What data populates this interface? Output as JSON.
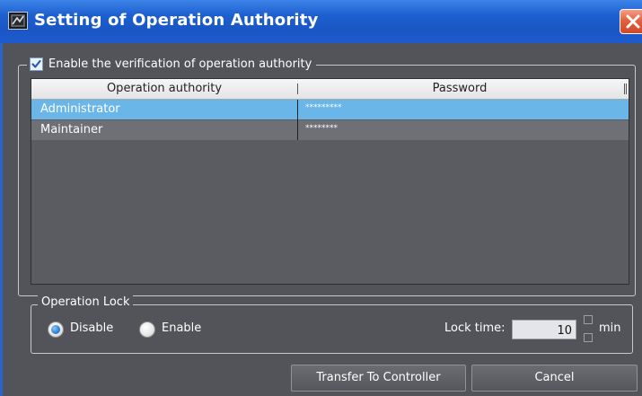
{
  "window": {
    "title": "Setting of Operation Authority"
  },
  "verification": {
    "label": "Enable the verification of operation authority",
    "checked": true
  },
  "table": {
    "columns": [
      "Operation authority",
      "Password"
    ],
    "rows": [
      {
        "authority": "Administrator",
        "password": "*********",
        "selected": true
      },
      {
        "authority": "Maintainer",
        "password": "********",
        "selected": false
      }
    ]
  },
  "operation_lock": {
    "title": "Operation Lock",
    "options": [
      "Disable",
      "Enable"
    ],
    "selected": "Disable",
    "lock_time_label": "Lock time:",
    "lock_time_value": "10",
    "unit": "min"
  },
  "buttons": {
    "transfer": "Transfer To Controller",
    "cancel": "Cancel"
  },
  "colors": {
    "titlebar": "#1d5fd0",
    "selection": "#6ab6e8",
    "background": "#525459"
  }
}
